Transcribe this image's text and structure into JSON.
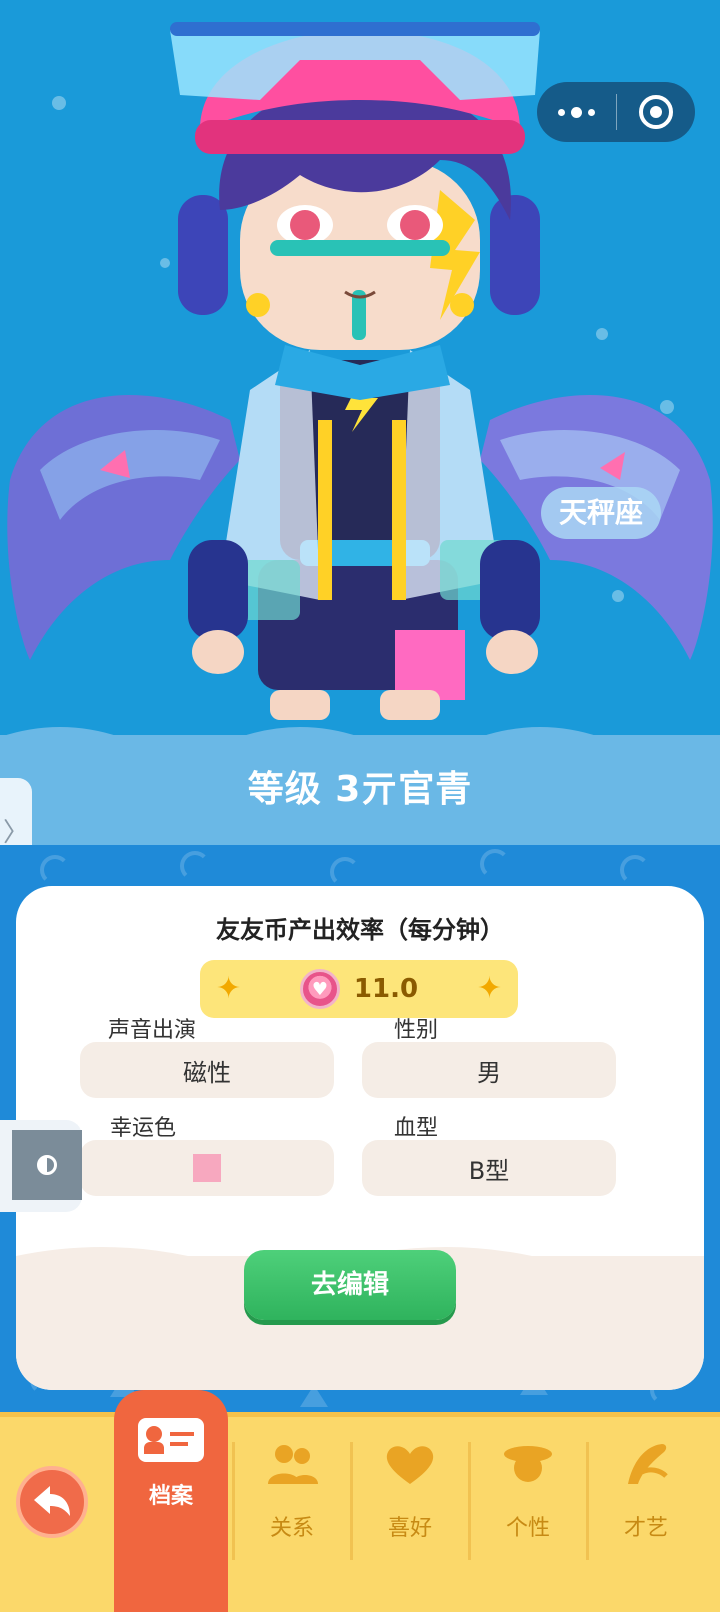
{
  "capsule": {
    "more_icon": "more-dots-icon",
    "close_icon": "target-close-icon"
  },
  "hero": {
    "zodiac": "天秤座"
  },
  "level": "等级 3亓官青",
  "side_tab": {
    "glyph": "〉"
  },
  "card": {
    "rate_title": "友友币产出效率（每分钟）",
    "rate_value": "11.0",
    "fields": {
      "voice_label": "声音出演",
      "voice_value": "磁性",
      "gender_label": "性别",
      "gender_value": "男",
      "lucky_color_label": "幸运色",
      "lucky_color_value": "#f7a8bf",
      "blood_label": "血型",
      "blood_value": "B型"
    },
    "edit_button": "去编辑"
  },
  "nav": {
    "active_tab": "档案",
    "tabs": [
      "关系",
      "喜好",
      "个性",
      "才艺"
    ]
  },
  "colors": {
    "sky": "#1a9ad9",
    "accent_orange": "#f0663f",
    "nav_yellow": "#fbd86a",
    "green_button": "#2fb35d"
  }
}
